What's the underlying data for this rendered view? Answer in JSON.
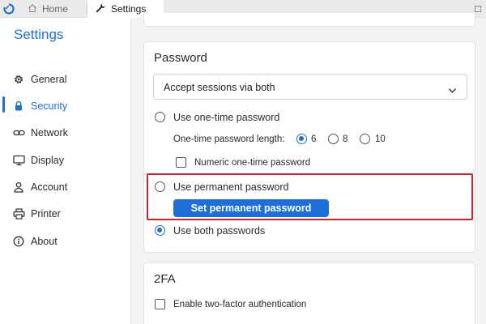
{
  "tabs": [
    {
      "label": "Home",
      "icon": "home-icon"
    },
    {
      "label": "Settings",
      "icon": "wrench-icon"
    }
  ],
  "window_control": "□",
  "sidebar": {
    "title": "Settings",
    "items": [
      {
        "label": "General",
        "icon": "gear-icon"
      },
      {
        "label": "Security",
        "icon": "lock-icon",
        "active": true
      },
      {
        "label": "Network",
        "icon": "link-icon"
      },
      {
        "label": "Display",
        "icon": "monitor-icon"
      },
      {
        "label": "Account",
        "icon": "user-icon"
      },
      {
        "label": "Printer",
        "icon": "printer-icon"
      },
      {
        "label": "About",
        "icon": "info-icon"
      }
    ]
  },
  "password": {
    "title": "Password",
    "session_select": "Accept sessions via both",
    "one_time_option": "Use one-time password",
    "length_label": "One-time password length:",
    "length_options": [
      "6",
      "8",
      "10"
    ],
    "length_selected": "6",
    "numeric_option": "Numeric one-time password",
    "permanent_option": "Use permanent password",
    "set_permanent_button": "Set permanent password",
    "both_option": "Use both passwords",
    "selected_mode": "Use both passwords"
  },
  "twofa": {
    "title": "2FA",
    "enable_option": "Enable two-factor authentication"
  },
  "colors": {
    "accent": "#1e6fd9",
    "highlight": "#d2242a"
  }
}
